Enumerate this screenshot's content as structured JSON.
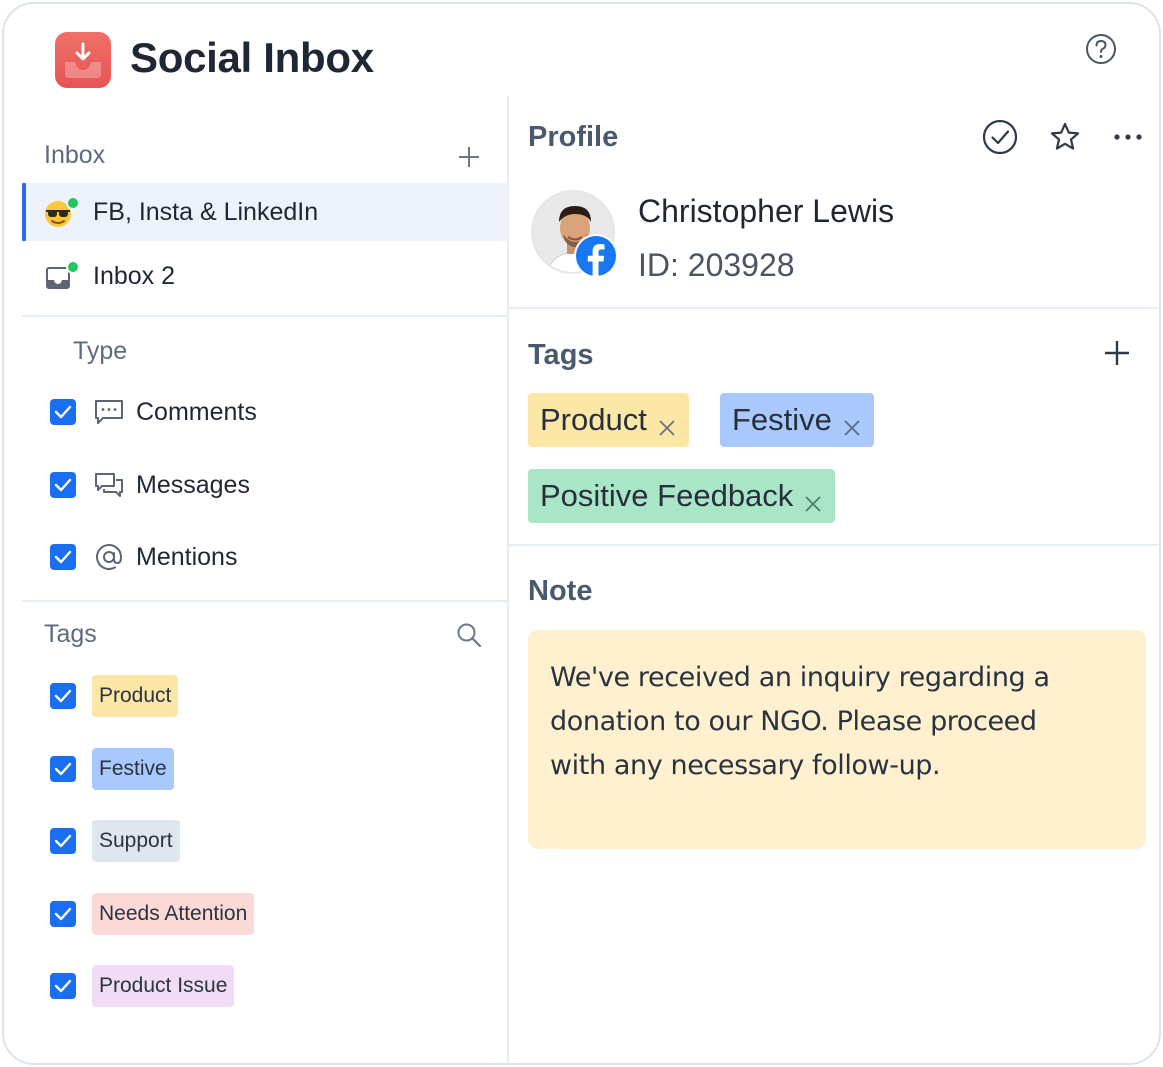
{
  "app": {
    "title": "Social Inbox",
    "logo_icon": "inbox-download-icon",
    "help_icon": "help-circle-icon",
    "brand_color": "#e65454"
  },
  "sidebar": {
    "inbox_section": {
      "label": "Inbox",
      "add_icon": "plus-icon",
      "items": [
        {
          "label": "FB, Insta & LinkedIn",
          "icon": "sunglasses-emoji-icon",
          "active": true,
          "status": "online"
        },
        {
          "label": "Inbox 2",
          "icon": "inbox-tray-icon",
          "active": false,
          "status": "online"
        }
      ]
    },
    "type_section": {
      "label": "Type",
      "items": [
        {
          "label": "Comments",
          "icon": "comment-icon",
          "checked": true
        },
        {
          "label": "Messages",
          "icon": "messages-icon",
          "checked": true
        },
        {
          "label": "Mentions",
          "icon": "at-icon",
          "checked": true
        }
      ]
    },
    "tags_section": {
      "label": "Tags",
      "search_icon": "search-icon",
      "items": [
        {
          "label": "Product",
          "color": "#fde7a6",
          "checked": true
        },
        {
          "label": "Festive",
          "color": "#a9c8fb",
          "checked": true
        },
        {
          "label": "Support",
          "color": "#dfe6ef",
          "checked": true
        },
        {
          "label": "Needs Attention",
          "color": "#fbd9d6",
          "checked": true
        },
        {
          "label": "Product Issue",
          "color": "#f1dcf5",
          "checked": true
        }
      ]
    }
  },
  "profile": {
    "section_label": "Profile",
    "actions": [
      "check-circle-icon",
      "star-icon",
      "more-horizontal-icon"
    ],
    "name": "Christopher Lewis",
    "id_text": "ID: 203928",
    "network_icon": "facebook-icon"
  },
  "tags_panel": {
    "label": "Tags",
    "add_icon": "plus-icon",
    "tags": [
      {
        "label": "Product",
        "color": "#fde7a6"
      },
      {
        "label": "Festive",
        "color": "#a9c8fb"
      },
      {
        "label": "Positive Feedback",
        "color": "#a8e6c7"
      }
    ]
  },
  "note": {
    "label": "Note",
    "text_lines": [
      "We've received an inquiry regarding a",
      "donation to our NGO. Please proceed",
      "with any necessary follow-up."
    ],
    "background": "#fff1cf"
  }
}
